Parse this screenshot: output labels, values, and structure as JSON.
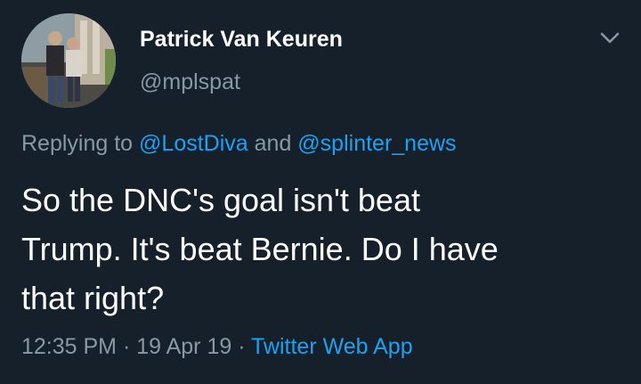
{
  "tweet": {
    "author": {
      "display_name": "Patrick Van Keuren",
      "handle": "@mplspat",
      "avatar_icon": "profile-photo"
    },
    "menu_icon": "chevron-down-icon",
    "reply": {
      "prefix": "Replying to ",
      "mention_1": "@LostDiva",
      "joiner": " and ",
      "mention_2": "@splinter_news"
    },
    "text": "So the DNC's goal isn't beat\nTrump. It's beat Bernie. Do I have\nthat right?",
    "meta": {
      "time": "12:35 PM",
      "sep_1": " · ",
      "date": "19 Apr 19",
      "sep_2": " · ",
      "source": "Twitter Web App"
    }
  },
  "colors": {
    "background": "#15202b",
    "text_primary": "#ffffff",
    "text_secondary": "#8899a6",
    "link": "#1da1f2"
  }
}
